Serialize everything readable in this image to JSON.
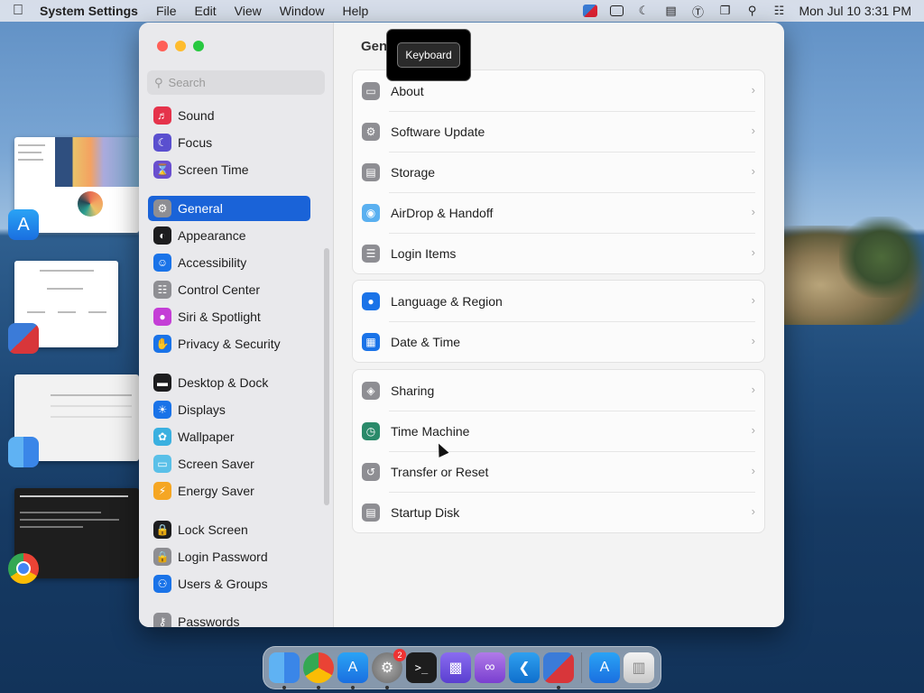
{
  "menubar": {
    "app_name": "System Settings",
    "menus": [
      "File",
      "Edit",
      "View",
      "Window",
      "Help"
    ],
    "clock": "Mon Jul 10  3:31 PM"
  },
  "sidebar": {
    "search_placeholder": "Search",
    "items": [
      {
        "label": "Sound",
        "icon": "speaker-icon",
        "color": "#e5334b"
      },
      {
        "label": "Focus",
        "icon": "moon-icon",
        "color": "#5a4fcf"
      },
      {
        "label": "Screen Time",
        "icon": "hourglass-icon",
        "color": "#6a4fcf"
      },
      {
        "label": "General",
        "icon": "gear-icon",
        "color": "#8e8e93"
      },
      {
        "label": "Appearance",
        "icon": "appearance-icon",
        "color": "#1d1d1f"
      },
      {
        "label": "Accessibility",
        "icon": "accessibility-icon",
        "color": "#1a73e8"
      },
      {
        "label": "Control Center",
        "icon": "control-center-icon",
        "color": "#8e8e93"
      },
      {
        "label": "Siri & Spotlight",
        "icon": "siri-icon",
        "color": "#c43ed6"
      },
      {
        "label": "Privacy & Security",
        "icon": "hand-icon",
        "color": "#1a73e8"
      },
      {
        "label": "Desktop & Dock",
        "icon": "dock-icon",
        "color": "#1d1d1f"
      },
      {
        "label": "Displays",
        "icon": "sun-icon",
        "color": "#1a73e8"
      },
      {
        "label": "Wallpaper",
        "icon": "flower-icon",
        "color": "#3ab0e0"
      },
      {
        "label": "Screen Saver",
        "icon": "screen-saver-icon",
        "color": "#5ac0e8"
      },
      {
        "label": "Energy Saver",
        "icon": "battery-icon",
        "color": "#f5a623"
      },
      {
        "label": "Lock Screen",
        "icon": "lock-icon",
        "color": "#1d1d1f"
      },
      {
        "label": "Login Password",
        "icon": "lock-icon",
        "color": "#8e8e93"
      },
      {
        "label": "Users & Groups",
        "icon": "users-icon",
        "color": "#1a73e8"
      },
      {
        "label": "Passwords",
        "icon": "key-icon",
        "color": "#8e8e93"
      }
    ],
    "active_index": 3
  },
  "content": {
    "title": "General",
    "groups": [
      [
        {
          "label": "About",
          "icon": "display-icon",
          "color": "#8e8e93"
        },
        {
          "label": "Software Update",
          "icon": "gear-icon",
          "color": "#8e8e93"
        },
        {
          "label": "Storage",
          "icon": "drive-icon",
          "color": "#8e8e93"
        },
        {
          "label": "AirDrop & Handoff",
          "icon": "airdrop-icon",
          "color": "#5ab0f0"
        },
        {
          "label": "Login Items",
          "icon": "list-icon",
          "color": "#8e8e93"
        }
      ],
      [
        {
          "label": "Language & Region",
          "icon": "globe-icon",
          "color": "#1a73e8"
        },
        {
          "label": "Date & Time",
          "icon": "calendar-icon",
          "color": "#1a73e8"
        }
      ],
      [
        {
          "label": "Sharing",
          "icon": "sharing-icon",
          "color": "#8e8e93"
        },
        {
          "label": "Time Machine",
          "icon": "time-machine-icon",
          "color": "#2a8a6a"
        },
        {
          "label": "Transfer or Reset",
          "icon": "reset-icon",
          "color": "#8e8e93"
        },
        {
          "label": "Startup Disk",
          "icon": "disk-icon",
          "color": "#8e8e93"
        }
      ]
    ]
  },
  "tooltip": "Keyboard",
  "dock": {
    "trash_label": "",
    "settings_badge": "2"
  }
}
